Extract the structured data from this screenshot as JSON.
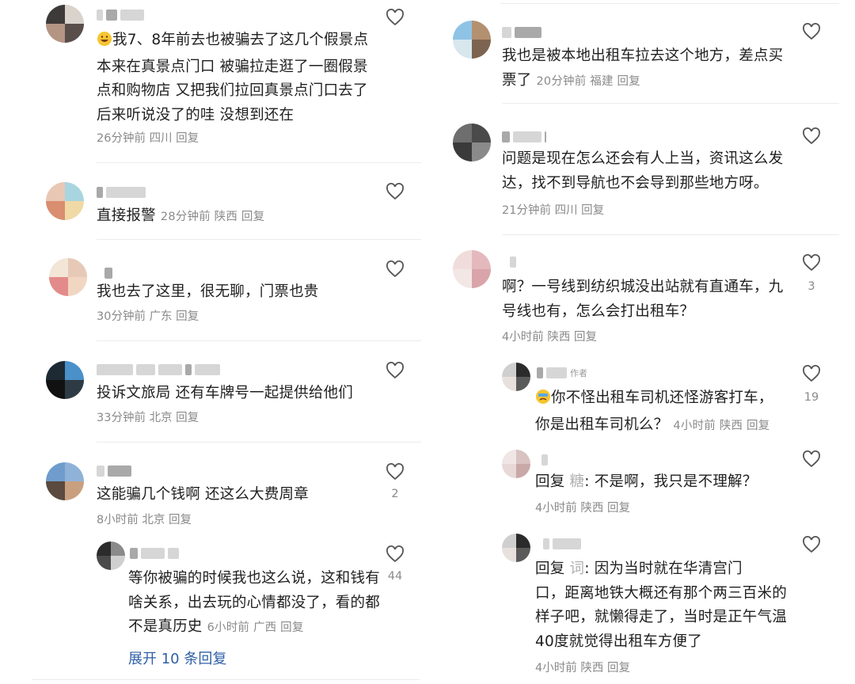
{
  "left": {
    "comments": [
      {
        "text_lines": [
          "我7、8年前去也被骗去了这几个假景点",
          "本来在真景点门口 被骗拉走逛了一圈假景",
          "点和购物店 又把我们拉回真景点门口去了",
          "后来听说没了的哇 没想到还在"
        ],
        "time": "26分钟前",
        "location": "四川",
        "reply": "回复",
        "likes": ""
      },
      {
        "text_lines": [
          "直接报警"
        ],
        "time": "28分钟前",
        "location": "陕西",
        "reply": "回复",
        "likes": ""
      },
      {
        "text_lines": [
          "我也去了这里，很无聊，门票也贵"
        ],
        "time": "30分钟前",
        "location": "广东",
        "reply": "回复",
        "likes": ""
      },
      {
        "text_lines": [
          "投诉文旅局 还有车牌号一起提供给他们"
        ],
        "time": "33分钟前",
        "location": "北京",
        "reply": "回复",
        "likes": ""
      },
      {
        "text_lines": [
          "这能骗几个钱啊 还这么大费周章"
        ],
        "time": "8小时前",
        "location": "北京",
        "reply": "回复",
        "likes": "2"
      }
    ],
    "sub_reply": {
      "text_lines": [
        "等你被骗的时候我也这么说，这和钱有",
        "啥关系，出去玩的心情都没了，看的都",
        "不是真历史"
      ],
      "time": "6小时前",
      "location": "广西",
      "reply": "回复",
      "likes": "44"
    },
    "expand_label": "展开 10 条回复"
  },
  "right": {
    "comments": [
      {
        "text_lines": [
          "我也是被本地出租车拉去这个地方，差点买",
          "票了"
        ],
        "time": "20分钟前",
        "location": "福建",
        "reply": "回复",
        "likes": ""
      },
      {
        "text_lines": [
          "问题是现在怎么还会有人上当，资讯这么发",
          "达，找不到导航也不会导到那些地方呀。"
        ],
        "time": "21分钟前",
        "location": "四川",
        "reply": "回复",
        "likes": ""
      },
      {
        "text_lines": [
          "啊？一号线到纺织城没出站就有直通车，九",
          "号线也有，怎么会打出租车？"
        ],
        "time": "4小时前",
        "location": "陕西",
        "reply": "回复",
        "likes": "3"
      }
    ],
    "sub_replies": [
      {
        "author_tag": "作者",
        "text_lines": [
          "你不怪出租车司机还怪游客打车，",
          "你是出租车司机么？"
        ],
        "time": "4小时前",
        "location": "陕西",
        "reply": "回复",
        "likes": "19"
      },
      {
        "reply_prefix": "回复",
        "reply_to": "糖",
        "text_lines": [
          ": 不是啊，我只是不理解？"
        ],
        "time": "4小时前",
        "location": "陕西",
        "reply": "回复",
        "likes": ""
      },
      {
        "reply_prefix": "回复",
        "reply_to": "词",
        "text_lines": [
          ": 因为当时就在华清宫门",
          "口，距离地铁大概还有那个两三百米的",
          "样子吧，就懒得走了，当时是正午气温",
          "40度就觉得出租车方便了"
        ],
        "time": "4小时前",
        "location": "陕西",
        "reply": "回复",
        "likes": ""
      }
    ]
  },
  "icons": {
    "like": "heart-outline-icon",
    "emoji_laugh": "grin-emoji-icon",
    "emoji_cry": "crying-emoji-icon"
  },
  "colors": {
    "text": "#1f1f1f",
    "meta": "#8a8a8a",
    "link": "#2f5fa7",
    "divider": "#ececec"
  }
}
